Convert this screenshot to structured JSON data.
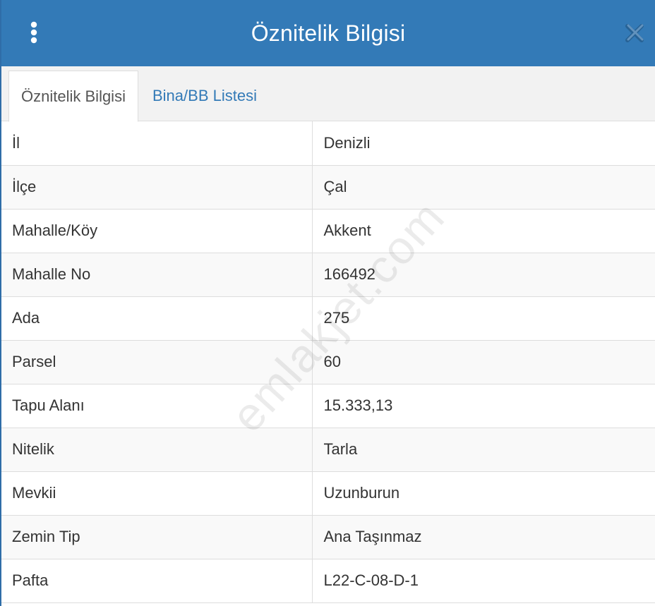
{
  "header": {
    "title": "Öznitelik Bilgisi",
    "menu_icon": "vertical-dots-icon",
    "close_icon": "close-icon"
  },
  "tabs": [
    {
      "label": "Öznitelik Bilgisi",
      "active": true
    },
    {
      "label": "Bina/BB Listesi",
      "active": false
    }
  ],
  "rows": [
    {
      "label": "İl",
      "value": "Denizli"
    },
    {
      "label": "İlçe",
      "value": "Çal"
    },
    {
      "label": "Mahalle/Köy",
      "value": "Akkent"
    },
    {
      "label": "Mahalle No",
      "value": "166492"
    },
    {
      "label": "Ada",
      "value": "275"
    },
    {
      "label": "Parsel",
      "value": "60"
    },
    {
      "label": "Tapu Alanı",
      "value": "15.333,13"
    },
    {
      "label": "Nitelik",
      "value": "Tarla"
    },
    {
      "label": "Mevkii",
      "value": "Uzunburun"
    },
    {
      "label": "Zemin Tip",
      "value": "Ana Taşınmaz"
    },
    {
      "label": "Pafta",
      "value": "L22-C-08-D-1"
    }
  ],
  "watermark": "emlakjet.com",
  "colors": {
    "header_bg": "#337ab7",
    "link": "#337ab7",
    "border": "#dddddd"
  }
}
